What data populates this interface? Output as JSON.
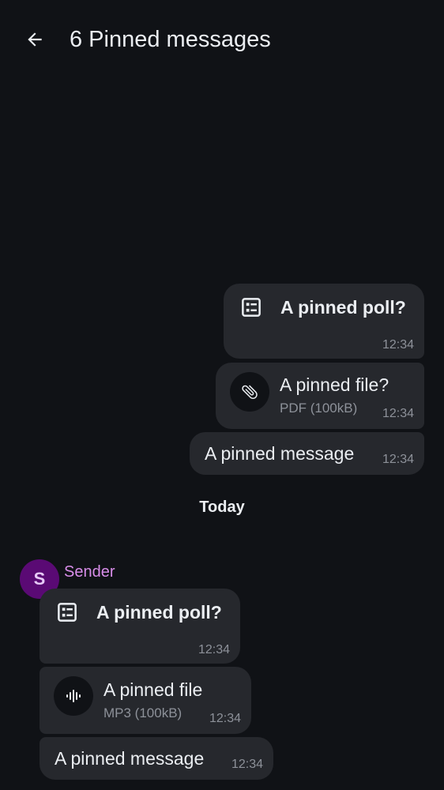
{
  "header": {
    "title": "6 Pinned messages",
    "back_icon": "arrow-left-icon"
  },
  "outgoing": {
    "poll": {
      "title": "A pinned poll?",
      "time": "12:34",
      "icon": "poll-icon"
    },
    "file": {
      "title": "A pinned file?",
      "subtitle": "PDF (100kB)",
      "time": "12:34",
      "icon": "paperclip-icon"
    },
    "message": {
      "text": "A pinned message",
      "time": "12:34"
    }
  },
  "day_separator": "Today",
  "incoming": {
    "sender": {
      "name": "Sender",
      "avatar_initial": "S",
      "avatar_color": "#5a0a74",
      "name_color": "#d88de9"
    },
    "poll": {
      "title": "A pinned poll?",
      "time": "12:34",
      "icon": "poll-icon"
    },
    "file": {
      "title": "A pinned file",
      "subtitle": "MP3 (100kB)",
      "time": "12:34",
      "icon": "audio-waveform-icon"
    },
    "message": {
      "text": "A pinned message",
      "time": "12:34"
    }
  },
  "colors": {
    "background": "#101216",
    "bubble": "#26282d",
    "text": "#ebeef2",
    "secondary_text": "#8d9199"
  }
}
